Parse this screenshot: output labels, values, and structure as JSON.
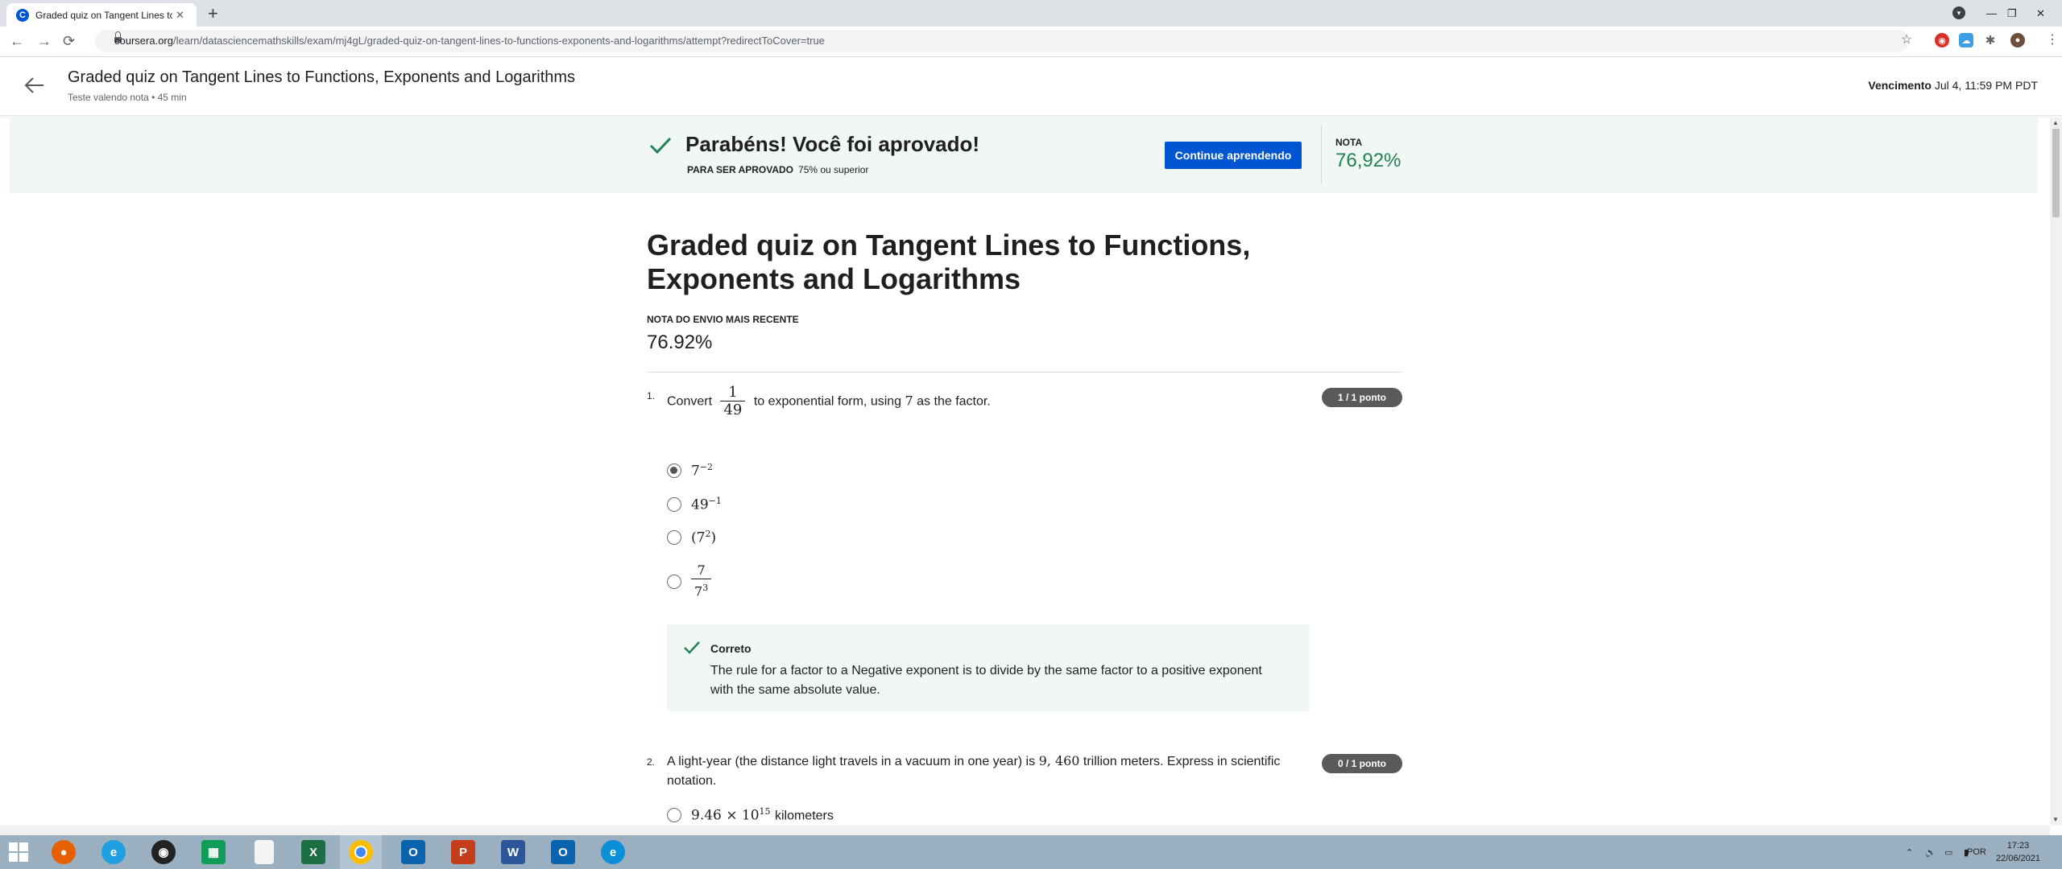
{
  "browser": {
    "tab_title": "Graded quiz on Tangent Lines to",
    "tab_close": "✕",
    "new_tab": "+",
    "url_domain": "coursera.org",
    "url_path": "/learn/datasciencemathskills/exam/mj4gL/graded-quiz-on-tangent-lines-to-functions-exponents-and-logarithms/attempt?redirectToCover=true",
    "back_icon": "←",
    "forward_icon": "→",
    "reload_icon": "⟳",
    "star_icon": "☆",
    "minimize": "—",
    "maximize": "❐",
    "close": "✕",
    "menu": "⋮"
  },
  "header": {
    "title": "Graded quiz on Tangent Lines to Functions, Exponents and Logarithms",
    "subtitle": "Teste valendo nota • 45 min",
    "due_label": "Vencimento",
    "due_value": "Jul 4, 11:59 PM PDT"
  },
  "banner": {
    "title": "Parabéns! Você foi aprovado!",
    "pass_label": "PARA SER APROVADO",
    "pass_value": "75% ou superior",
    "continue_button": "Continue aprendendo",
    "grade_label": "NOTA",
    "grade_value": "76,92%"
  },
  "main": {
    "title": "Graded quiz on Tangent Lines to Functions, Exponents and Logarithms",
    "recent_label": "NOTA DO ENVIO MAIS RECENTE",
    "recent_value": "76.92%"
  },
  "questions": [
    {
      "number": "1.",
      "text_before": "Convert",
      "frac_num": "1",
      "frac_den": "49",
      "text_after": "to exponential form, using",
      "factor": "7",
      "text_end": "as the factor.",
      "points": "1 / 1 ponto",
      "options": [
        {
          "base": "7",
          "exp": "−2",
          "selected": true
        },
        {
          "base": "49",
          "exp": "−1",
          "selected": false
        },
        {
          "base": "(7",
          "exp": "2",
          "tail": ")",
          "selected": false
        },
        {
          "num": "7",
          "den_base": "7",
          "den_exp": "3",
          "selected": false
        }
      ],
      "feedback_label": "Correto",
      "feedback_text": "The rule for  a factor to a Negative exponent is to divide by the same factor to a positive exponent with the same absolute value."
    },
    {
      "number": "2.",
      "text_before": "A light-year (the distance light travels in a vacuum in one year) is",
      "value": "9, 460",
      "text_after": "trillion meters. Express in scientific notation.",
      "points": "0 / 1 ponto",
      "options": [
        {
          "mantissa": "9.46 × 10",
          "exp": "15",
          "unit": "kilometers",
          "selected": false
        }
      ]
    }
  ],
  "taskbar": {
    "apps": [
      "start",
      "firefox",
      "internet-explorer",
      "obs",
      "sheets",
      "file",
      "excel",
      "chrome",
      "outlook",
      "powerpoint",
      "word",
      "outlook-2",
      "edge"
    ],
    "lang": "POR",
    "time": "17:23",
    "date": "22/06/2021"
  },
  "colors": {
    "brand_blue": "#0056d2",
    "success_green": "#1f8354",
    "banner_bg": "#f1f7f4"
  }
}
